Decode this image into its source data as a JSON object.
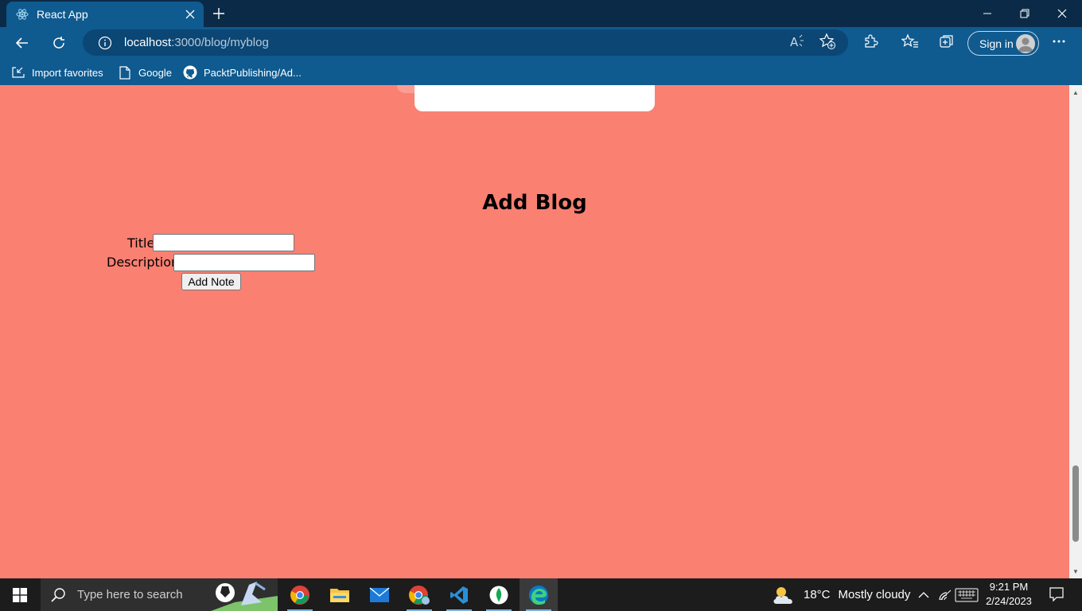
{
  "browser": {
    "tab_title": "React App",
    "url_host": "localhost",
    "url_path": ":3000/blog/myblog",
    "signin_label": "Sign in"
  },
  "favorites": [
    {
      "label": "Import favorites",
      "icon": "import-favorites-icon"
    },
    {
      "label": "Google",
      "icon": "page-icon"
    },
    {
      "label": "PacktPublishing/Ad...",
      "icon": "github-icon"
    }
  ],
  "page": {
    "heading": "Add Blog",
    "form": {
      "title_label": "Title",
      "title_value": "",
      "description_label": "Description",
      "description_value": "",
      "submit_label": "Add Note"
    },
    "background_color": "#fa8072"
  },
  "taskbar": {
    "search_placeholder": "Type here to search",
    "weather_temp": "18°C",
    "weather_text": "Mostly cloudy",
    "time": "9:21 PM",
    "date": "2/24/2023",
    "apps": [
      "chrome-icon",
      "file-explorer-icon",
      "mail-icon",
      "chrome-profile-icon",
      "vscode-icon",
      "mongodb-compass-icon",
      "edge-icon"
    ]
  }
}
